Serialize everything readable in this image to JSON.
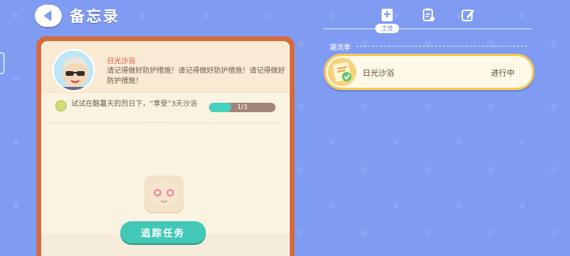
{
  "header": {
    "title": "备忘录"
  },
  "tabs": [
    {
      "icon": "book-plus-icon",
      "label": "主线",
      "active": true
    },
    {
      "icon": "clipboard-gear-icon",
      "label": "",
      "active": false
    },
    {
      "icon": "note-pencil-icon",
      "label": "",
      "active": false
    }
  ],
  "task": {
    "name": "日光沙浴",
    "description": "请记得做好防护措施！请记得做好防护措施！请记得做好防护措施！",
    "objective": {
      "text": "试试在酷暑天的烈日下，“享受”3天沙浴",
      "progress_text": "1/3",
      "progress_value": 0.333
    },
    "track_button": "追踪任务"
  },
  "quest_list": {
    "section": "潮流季",
    "items": [
      {
        "name": "日光沙浴",
        "status": "进行中"
      }
    ]
  },
  "colors": {
    "background": "#7f9bf2",
    "panel_border": "#d46a3c",
    "accent_teal": "#42c8b6",
    "task_name_red": "#e0523c",
    "card_border_gold": "#f4c95a"
  }
}
